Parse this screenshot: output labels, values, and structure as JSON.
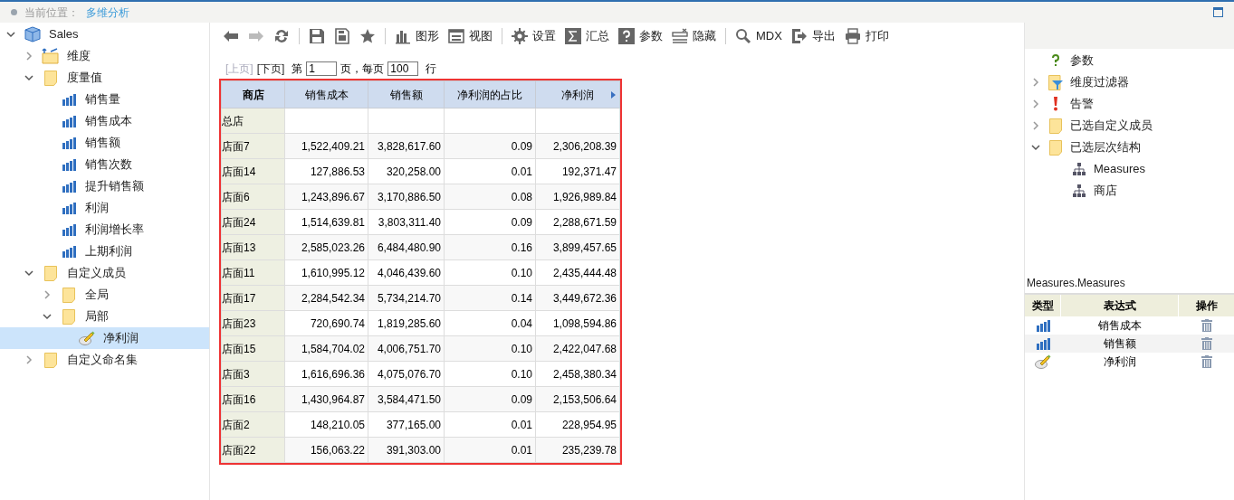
{
  "breadcrumb": {
    "label": "当前位置：",
    "current": "多维分析"
  },
  "tree": [
    {
      "label": "Sales",
      "kind": "cube",
      "expanded": true,
      "selected": false,
      "children": [
        {
          "label": "维度",
          "kind": "dimension",
          "expanded": false,
          "selected": false
        },
        {
          "label": "度量值",
          "kind": "folder",
          "expanded": true,
          "selected": false,
          "children": [
            {
              "label": "销售量",
              "kind": "measure",
              "selected": false
            },
            {
              "label": "销售成本",
              "kind": "measure",
              "selected": false
            },
            {
              "label": "销售额",
              "kind": "measure",
              "selected": false
            },
            {
              "label": "销售次数",
              "kind": "measure",
              "selected": false
            },
            {
              "label": "提升销售额",
              "kind": "measure",
              "selected": false
            },
            {
              "label": "利润",
              "kind": "measure",
              "selected": false
            },
            {
              "label": "利润增长率",
              "kind": "measure",
              "selected": false
            },
            {
              "label": "上期利润",
              "kind": "measure",
              "selected": false
            }
          ]
        },
        {
          "label": "自定义成员",
          "kind": "folder",
          "expanded": true,
          "selected": false,
          "children": [
            {
              "label": "全局",
              "kind": "folder",
              "expanded": false,
              "selected": false
            },
            {
              "label": "局部",
              "kind": "folder",
              "expanded": true,
              "selected": false,
              "children": [
                {
                  "label": "净利润",
                  "kind": "calc",
                  "selected": true
                }
              ]
            }
          ]
        },
        {
          "label": "自定义命名集",
          "kind": "folder",
          "expanded": false,
          "selected": false
        }
      ]
    }
  ],
  "toolbar": [
    {
      "kind": "back",
      "disabled": false
    },
    {
      "kind": "forward",
      "disabled": true
    },
    {
      "kind": "refresh",
      "disabled": false
    },
    {
      "kind": "sep"
    },
    {
      "kind": "save",
      "disabled": false
    },
    {
      "kind": "saveas",
      "disabled": false
    },
    {
      "kind": "star",
      "disabled": false
    },
    {
      "kind": "sep"
    },
    {
      "kind": "chart",
      "label": "图形",
      "disabled": false
    },
    {
      "kind": "view",
      "label": "视图",
      "disabled": false
    },
    {
      "kind": "sep"
    },
    {
      "kind": "gear",
      "label": "设置",
      "disabled": false
    },
    {
      "kind": "sigma",
      "label": "汇总",
      "disabled": false
    },
    {
      "kind": "help",
      "label": "参数",
      "disabled": false
    },
    {
      "kind": "hide",
      "label": "隐藏",
      "disabled": false
    },
    {
      "kind": "sep"
    },
    {
      "kind": "search",
      "label": "MDX",
      "disabled": false
    },
    {
      "kind": "export",
      "label": "导出",
      "disabled": false
    },
    {
      "kind": "print",
      "label": "打印",
      "disabled": false
    }
  ],
  "pager": {
    "prev": {
      "label": "[上页]",
      "disabled": true
    },
    "next": {
      "label": "[下页]",
      "disabled": false
    },
    "page_label": "第",
    "page": "1",
    "per_page_label": "页，每页",
    "per_page": "100",
    "rows_label": "行"
  },
  "table": {
    "columns": [
      "商店",
      "销售成本",
      "销售额",
      "净利润的占比",
      "净利润"
    ],
    "rows": [
      [
        "总店",
        "",
        "",
        "",
        ""
      ],
      [
        "店面7",
        "1,522,409.21",
        "3,828,617.60",
        "0.09",
        "2,306,208.39"
      ],
      [
        "店面14",
        "127,886.53",
        "320,258.00",
        "0.01",
        "192,371.47"
      ],
      [
        "店面6",
        "1,243,896.67",
        "3,170,886.50",
        "0.08",
        "1,926,989.84"
      ],
      [
        "店面24",
        "1,514,639.81",
        "3,803,311.40",
        "0.09",
        "2,288,671.59"
      ],
      [
        "店面13",
        "2,585,023.26",
        "6,484,480.90",
        "0.16",
        "3,899,457.65"
      ],
      [
        "店面11",
        "1,610,995.12",
        "4,046,439.60",
        "0.10",
        "2,435,444.48"
      ],
      [
        "店面17",
        "2,284,542.34",
        "5,734,214.70",
        "0.14",
        "3,449,672.36"
      ],
      [
        "店面23",
        "720,690.74",
        "1,819,285.60",
        "0.04",
        "1,098,594.86"
      ],
      [
        "店面15",
        "1,584,704.02",
        "4,006,751.70",
        "0.10",
        "2,422,047.68"
      ],
      [
        "店面3",
        "1,616,696.36",
        "4,075,076.70",
        "0.10",
        "2,458,380.34"
      ],
      [
        "店面16",
        "1,430,964.87",
        "3,584,471.50",
        "0.09",
        "2,153,506.64"
      ],
      [
        "店面2",
        "148,210.05",
        "377,165.00",
        "0.01",
        "228,954.95"
      ],
      [
        "店面22",
        "156,063.22",
        "391,303.00",
        "0.01",
        "235,239.78"
      ]
    ]
  },
  "right_tree": [
    {
      "label": "参数",
      "kind": "param"
    },
    {
      "label": "维度过滤器",
      "kind": "filter",
      "expanded": false
    },
    {
      "label": "告警",
      "kind": "alert",
      "expanded": false
    },
    {
      "label": "已选自定义成员",
      "kind": "folder",
      "expanded": false
    },
    {
      "label": "已选层次结构",
      "kind": "folder",
      "expanded": true,
      "children": [
        {
          "label": "Measures",
          "kind": "hierarchy"
        },
        {
          "label": "商店",
          "kind": "hierarchy"
        }
      ]
    }
  ],
  "measures": {
    "title": "Measures.Measures",
    "columns": [
      "类型",
      "表达式",
      "操作"
    ],
    "rows": [
      {
        "kind": "measure",
        "expression": "销售成本"
      },
      {
        "kind": "measure",
        "expression": "销售额"
      },
      {
        "kind": "calc",
        "expression": "净利润"
      }
    ]
  }
}
